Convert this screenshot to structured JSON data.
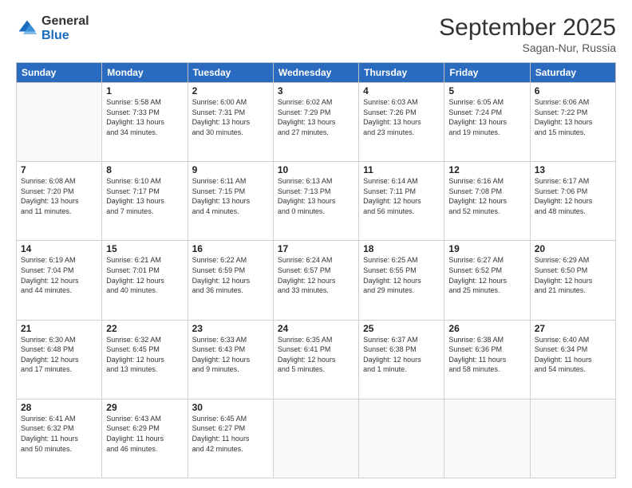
{
  "header": {
    "logo_general": "General",
    "logo_blue": "Blue",
    "title": "September 2025",
    "subtitle": "Sagan-Nur, Russia"
  },
  "columns": [
    "Sunday",
    "Monday",
    "Tuesday",
    "Wednesday",
    "Thursday",
    "Friday",
    "Saturday"
  ],
  "weeks": [
    [
      {
        "day": "",
        "info": ""
      },
      {
        "day": "1",
        "info": "Sunrise: 5:58 AM\nSunset: 7:33 PM\nDaylight: 13 hours\nand 34 minutes."
      },
      {
        "day": "2",
        "info": "Sunrise: 6:00 AM\nSunset: 7:31 PM\nDaylight: 13 hours\nand 30 minutes."
      },
      {
        "day": "3",
        "info": "Sunrise: 6:02 AM\nSunset: 7:29 PM\nDaylight: 13 hours\nand 27 minutes."
      },
      {
        "day": "4",
        "info": "Sunrise: 6:03 AM\nSunset: 7:26 PM\nDaylight: 13 hours\nand 23 minutes."
      },
      {
        "day": "5",
        "info": "Sunrise: 6:05 AM\nSunset: 7:24 PM\nDaylight: 13 hours\nand 19 minutes."
      },
      {
        "day": "6",
        "info": "Sunrise: 6:06 AM\nSunset: 7:22 PM\nDaylight: 13 hours\nand 15 minutes."
      }
    ],
    [
      {
        "day": "7",
        "info": "Sunrise: 6:08 AM\nSunset: 7:20 PM\nDaylight: 13 hours\nand 11 minutes."
      },
      {
        "day": "8",
        "info": "Sunrise: 6:10 AM\nSunset: 7:17 PM\nDaylight: 13 hours\nand 7 minutes."
      },
      {
        "day": "9",
        "info": "Sunrise: 6:11 AM\nSunset: 7:15 PM\nDaylight: 13 hours\nand 4 minutes."
      },
      {
        "day": "10",
        "info": "Sunrise: 6:13 AM\nSunset: 7:13 PM\nDaylight: 13 hours\nand 0 minutes."
      },
      {
        "day": "11",
        "info": "Sunrise: 6:14 AM\nSunset: 7:11 PM\nDaylight: 12 hours\nand 56 minutes."
      },
      {
        "day": "12",
        "info": "Sunrise: 6:16 AM\nSunset: 7:08 PM\nDaylight: 12 hours\nand 52 minutes."
      },
      {
        "day": "13",
        "info": "Sunrise: 6:17 AM\nSunset: 7:06 PM\nDaylight: 12 hours\nand 48 minutes."
      }
    ],
    [
      {
        "day": "14",
        "info": "Sunrise: 6:19 AM\nSunset: 7:04 PM\nDaylight: 12 hours\nand 44 minutes."
      },
      {
        "day": "15",
        "info": "Sunrise: 6:21 AM\nSunset: 7:01 PM\nDaylight: 12 hours\nand 40 minutes."
      },
      {
        "day": "16",
        "info": "Sunrise: 6:22 AM\nSunset: 6:59 PM\nDaylight: 12 hours\nand 36 minutes."
      },
      {
        "day": "17",
        "info": "Sunrise: 6:24 AM\nSunset: 6:57 PM\nDaylight: 12 hours\nand 33 minutes."
      },
      {
        "day": "18",
        "info": "Sunrise: 6:25 AM\nSunset: 6:55 PM\nDaylight: 12 hours\nand 29 minutes."
      },
      {
        "day": "19",
        "info": "Sunrise: 6:27 AM\nSunset: 6:52 PM\nDaylight: 12 hours\nand 25 minutes."
      },
      {
        "day": "20",
        "info": "Sunrise: 6:29 AM\nSunset: 6:50 PM\nDaylight: 12 hours\nand 21 minutes."
      }
    ],
    [
      {
        "day": "21",
        "info": "Sunrise: 6:30 AM\nSunset: 6:48 PM\nDaylight: 12 hours\nand 17 minutes."
      },
      {
        "day": "22",
        "info": "Sunrise: 6:32 AM\nSunset: 6:45 PM\nDaylight: 12 hours\nand 13 minutes."
      },
      {
        "day": "23",
        "info": "Sunrise: 6:33 AM\nSunset: 6:43 PM\nDaylight: 12 hours\nand 9 minutes."
      },
      {
        "day": "24",
        "info": "Sunrise: 6:35 AM\nSunset: 6:41 PM\nDaylight: 12 hours\nand 5 minutes."
      },
      {
        "day": "25",
        "info": "Sunrise: 6:37 AM\nSunset: 6:38 PM\nDaylight: 12 hours\nand 1 minute."
      },
      {
        "day": "26",
        "info": "Sunrise: 6:38 AM\nSunset: 6:36 PM\nDaylight: 11 hours\nand 58 minutes."
      },
      {
        "day": "27",
        "info": "Sunrise: 6:40 AM\nSunset: 6:34 PM\nDaylight: 11 hours\nand 54 minutes."
      }
    ],
    [
      {
        "day": "28",
        "info": "Sunrise: 6:41 AM\nSunset: 6:32 PM\nDaylight: 11 hours\nand 50 minutes."
      },
      {
        "day": "29",
        "info": "Sunrise: 6:43 AM\nSunset: 6:29 PM\nDaylight: 11 hours\nand 46 minutes."
      },
      {
        "day": "30",
        "info": "Sunrise: 6:45 AM\nSunset: 6:27 PM\nDaylight: 11 hours\nand 42 minutes."
      },
      {
        "day": "",
        "info": ""
      },
      {
        "day": "",
        "info": ""
      },
      {
        "day": "",
        "info": ""
      },
      {
        "day": "",
        "info": ""
      }
    ]
  ]
}
